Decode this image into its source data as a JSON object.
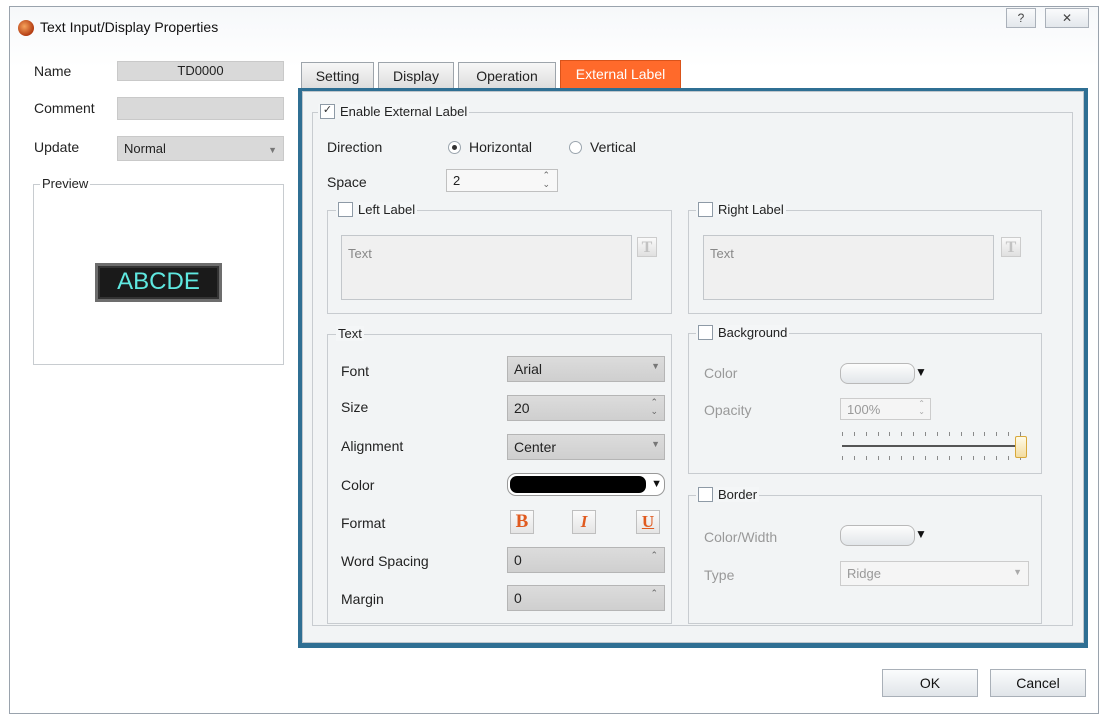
{
  "window": {
    "title": "Text Input/Display Properties",
    "help_label": "?",
    "close_label": "✕"
  },
  "left": {
    "name_label": "Name",
    "name_value": "TD0000",
    "comment_label": "Comment",
    "comment_value": "",
    "update_label": "Update",
    "update_value": "Normal",
    "preview_label": "Preview",
    "preview_text": "ABCDE"
  },
  "tabs": [
    {
      "label": "Setting"
    },
    {
      "label": "Display"
    },
    {
      "label": "Operation"
    },
    {
      "label": "External Label",
      "active": true
    }
  ],
  "external": {
    "enable_label": "Enable External Label",
    "enable_checked": true,
    "direction_label": "Direction",
    "horizontal_label": "Horizontal",
    "vertical_label": "Vertical",
    "direction_selected": "Horizontal",
    "space_label": "Space",
    "space_value": "2",
    "left_label": "Left Label",
    "left_text_placeholder": "Text",
    "right_label": "Right Label",
    "right_text_placeholder": "Text",
    "text_editor_glyph": "T"
  },
  "text_group": {
    "title": "Text",
    "font_label": "Font",
    "font_value": "Arial",
    "size_label": "Size",
    "size_value": "20",
    "alignment_label": "Alignment",
    "alignment_value": "Center",
    "color_label": "Color",
    "color_value": "#000000",
    "format_label": "Format",
    "bold_glyph": "B",
    "italic_glyph": "I",
    "underline_glyph": "U",
    "word_spacing_label": "Word Spacing",
    "word_spacing_value": "0",
    "margin_label": "Margin",
    "margin_value": "0"
  },
  "background": {
    "title": "Background",
    "color_label": "Color",
    "opacity_label": "Opacity",
    "opacity_value": "100%",
    "opacity_level": 1.0
  },
  "border": {
    "title": "Border",
    "color_width_label": "Color/Width",
    "type_label": "Type",
    "type_value": "Ridge"
  },
  "footer": {
    "ok_label": "OK",
    "cancel_label": "Cancel"
  },
  "colors": {
    "active_tab": "#ff6a2b",
    "panel_frame": "#2f6f93",
    "preview_text": "#5fe8e0"
  }
}
